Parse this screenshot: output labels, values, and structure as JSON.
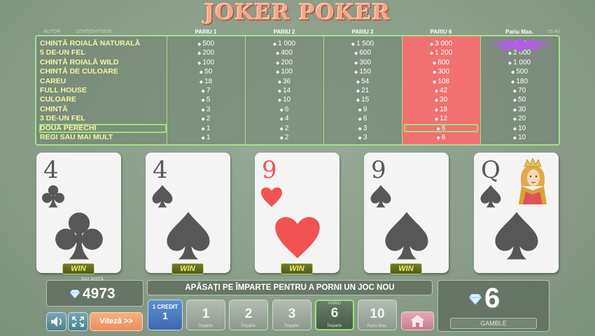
{
  "title": "JOKER POKER",
  "author_label": "AUTOR",
  "round_id": "179955547592B",
  "clock": "15:40",
  "bet_columns": [
    "PARIU 1",
    "PARIU 2",
    "PARIU 3",
    "PARIU 6",
    "Pariu Max."
  ],
  "selected_column_index": 3,
  "hands": [
    {
      "name": "CHINTĂ ROIALĂ NATURALĂ",
      "pays": [
        "500",
        "1 000",
        "1 500",
        "3 000",
        "9 500"
      ]
    },
    {
      "name": "5 DE-UN FEL",
      "pays": [
        "200",
        "400",
        "600",
        "1 200",
        "2 000"
      ]
    },
    {
      "name": "CHINTĂ ROIALĂ WILD",
      "pays": [
        "100",
        "200",
        "300",
        "600",
        "1 000"
      ]
    },
    {
      "name": "CHINTĂ DE CULOARE",
      "pays": [
        "50",
        "100",
        "150",
        "300",
        "500"
      ]
    },
    {
      "name": "CAREU",
      "pays": [
        "18",
        "36",
        "54",
        "108",
        "180"
      ]
    },
    {
      "name": "FULL HOUSE",
      "pays": [
        "7",
        "14",
        "21",
        "42",
        "70"
      ]
    },
    {
      "name": "CULOARE",
      "pays": [
        "5",
        "10",
        "15",
        "30",
        "50"
      ]
    },
    {
      "name": "CHINTĂ",
      "pays": [
        "3",
        "6",
        "9",
        "18",
        "30"
      ]
    },
    {
      "name": "3 DE-UN FEL",
      "pays": [
        "2",
        "4",
        "6",
        "12",
        "20"
      ]
    },
    {
      "name": "DOUĂ PERECHI",
      "pays": [
        "1",
        "2",
        "3",
        "6",
        "10"
      ]
    },
    {
      "name": "REGI SAU MAI MULT",
      "pays": [
        "1",
        "2",
        "3",
        "6",
        "10"
      ]
    }
  ],
  "winning_hand_index": 9,
  "cards": [
    {
      "rank": "4",
      "suit": "clubs",
      "color": "#575757",
      "win": "WIN"
    },
    {
      "rank": "4",
      "suit": "spades",
      "color": "#575757",
      "win": "WIN"
    },
    {
      "rank": "9",
      "suit": "hearts",
      "color": "#f25252",
      "win": "WIN"
    },
    {
      "rank": "9",
      "suit": "spades",
      "color": "#575757",
      "win": "WIN"
    },
    {
      "rank": "Q",
      "suit": "spades",
      "color": "#575757",
      "win": ""
    }
  ],
  "balance": {
    "label": "BALANȚĂ",
    "value": "4973"
  },
  "message": "APĂSAȚI PE ÎMPARTE PENTRU A PORNI UN JOC NOU",
  "win_amount": "6",
  "gamble_label": "GAMBLE",
  "speed_label": "Viteză >>",
  "credit": {
    "label": "1 CREDIT",
    "value": "1"
  },
  "bet_buttons": [
    {
      "value": "1",
      "sub": "Împarte"
    },
    {
      "value": "2",
      "sub": "Împarte"
    },
    {
      "value": "3",
      "sub": "Împarte"
    },
    {
      "value": "6",
      "sub": "Împarte",
      "top": "PARIU"
    },
    {
      "value": "10",
      "sub": "Pariu Max."
    }
  ],
  "selected_bet_index": 3,
  "icons": {
    "sound": "speaker-icon",
    "fullscreen": "fullscreen-icon",
    "home": "home-icon",
    "diamond": "diamond-icon"
  },
  "colors": {
    "selected_column": "#f07170",
    "highlight": "#9be07c",
    "title": "#f3a98b"
  }
}
